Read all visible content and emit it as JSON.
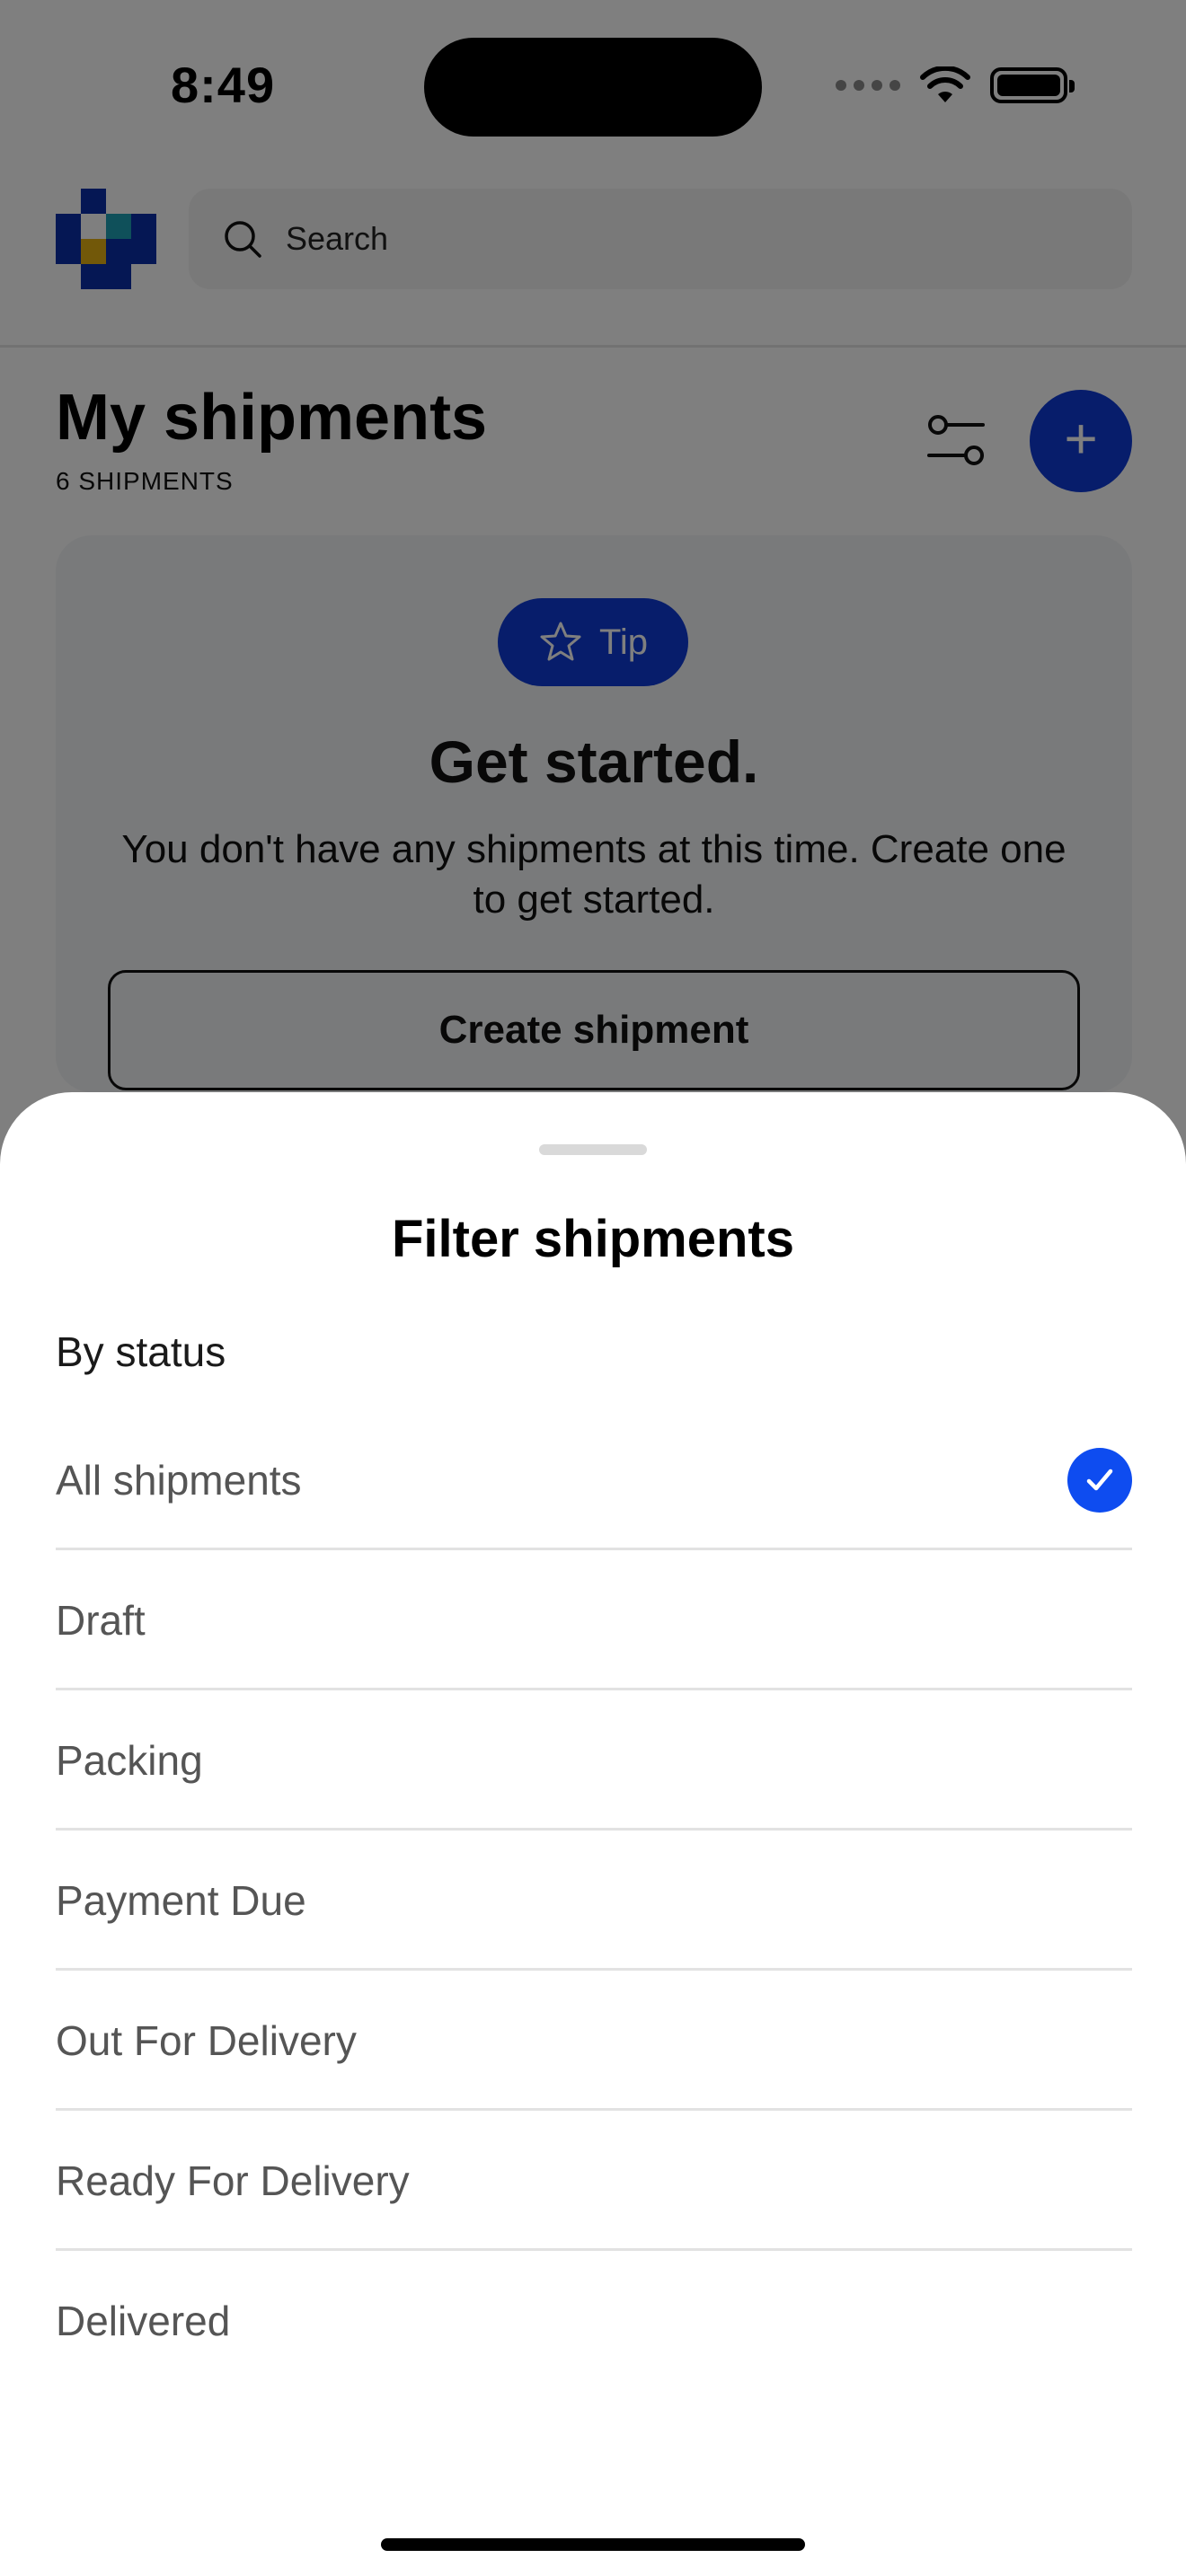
{
  "status_bar": {
    "time": "8:49"
  },
  "header": {
    "search_placeholder": "Search"
  },
  "page": {
    "title": "My shipments",
    "count_label": "6 SHIPMENTS"
  },
  "tip_card": {
    "badge": "Tip",
    "title": "Get started.",
    "description": "You don't have any shipments at this time. Create one to get started.",
    "button_label": "Create shipment"
  },
  "filter_sheet": {
    "title": "Filter shipments",
    "section_label": "By status",
    "options": [
      {
        "label": "All shipments",
        "selected": true
      },
      {
        "label": "Draft",
        "selected": false
      },
      {
        "label": "Packing",
        "selected": false
      },
      {
        "label": "Payment Due",
        "selected": false
      },
      {
        "label": "Out For Delivery",
        "selected": false
      },
      {
        "label": "Ready For Delivery",
        "selected": false
      },
      {
        "label": "Delivered",
        "selected": false
      }
    ]
  },
  "colors": {
    "accent": "#0e3bd6",
    "check": "#0e4cf0",
    "scrim": "rgba(0,0,0,0.5)"
  }
}
